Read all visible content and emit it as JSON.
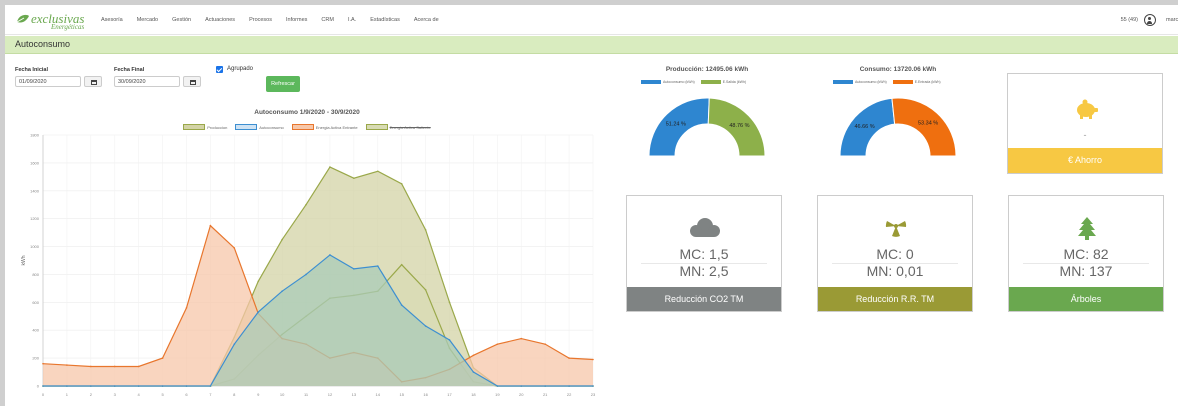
{
  "nav": {
    "logo_word": "exclusivas",
    "logo_sub": "Energéticas",
    "menu": [
      "Asesoría",
      "Mercado",
      "Gestión",
      "Actuaciones",
      "Procesos",
      "Informes",
      "CRM",
      "I.A.",
      "Estadísticas",
      "Acerca de"
    ],
    "count": "55 (49)",
    "user": "marco"
  },
  "page_title": "Autoconsumo",
  "filters": {
    "fecha_inicial_label": "Fecha Inicial",
    "fecha_inicial_value": "01/09/2020",
    "fecha_final_label": "Fecha Final",
    "fecha_final_value": "30/09/2020",
    "agrupado_label": "Agrupado",
    "agrupado_checked": true,
    "refresh_label": "Refrescar"
  },
  "chart_data": [
    {
      "type": "area",
      "title": "Autoconsumo 1/9/2020 - 30/9/2020",
      "xlabel": "",
      "ylabel": "kWh",
      "ylim": [
        0,
        1800
      ],
      "x": [
        0,
        1,
        2,
        3,
        4,
        5,
        6,
        7,
        8,
        9,
        10,
        11,
        12,
        13,
        14,
        15,
        16,
        17,
        18,
        19,
        20,
        21,
        22,
        23
      ],
      "yticks": [
        0,
        200,
        400,
        600,
        800,
        1000,
        1200,
        1400,
        1600,
        1800
      ],
      "grid": true,
      "legend_position": "top",
      "series": [
        {
          "name": "Produccion",
          "color": "#9aa84a",
          "fill": "#d3d3a6",
          "values": [
            0,
            0,
            0,
            0,
            0,
            0,
            0,
            0,
            350,
            750,
            1050,
            1300,
            1570,
            1490,
            1540,
            1450,
            1120,
            600,
            130,
            0,
            0,
            0,
            0,
            0
          ]
        },
        {
          "name": "Autoconsumo",
          "color": "#3d8fd1",
          "fill": "#a9cbb8",
          "values": [
            0,
            0,
            0,
            0,
            0,
            0,
            0,
            0,
            300,
            530,
            680,
            800,
            940,
            840,
            860,
            580,
            430,
            330,
            100,
            0,
            0,
            0,
            0,
            0
          ]
        },
        {
          "name": "Energia Activa Entrante",
          "color": "#e8762d",
          "fill": "#f7c7a9",
          "values": [
            160,
            150,
            140,
            140,
            140,
            200,
            560,
            1150,
            990,
            520,
            340,
            300,
            200,
            240,
            200,
            30,
            60,
            120,
            220,
            300,
            340,
            300,
            200,
            190
          ]
        },
        {
          "name": "Energia Activa Saliente",
          "color": "#9aa84a",
          "fill": "#d8dbb4",
          "values": [
            0,
            0,
            0,
            0,
            0,
            0,
            0,
            0,
            50,
            220,
            370,
            500,
            630,
            650,
            680,
            870,
            690,
            270,
            30,
            0,
            0,
            0,
            0,
            0
          ]
        }
      ]
    },
    {
      "type": "pie",
      "title": "Producción: 12495.06 kWh",
      "categories": [
        "Autoconsumo (kWh)",
        "E.Salida (kWh)"
      ],
      "values": [
        51.24,
        48.76
      ],
      "colors": [
        "#2e86d0",
        "#8db04a"
      ]
    },
    {
      "type": "pie",
      "title": "Consumo: 13720.06 kWh",
      "categories": [
        "Autoconsumo (kWh)",
        "E.Entrada (kWh)"
      ],
      "values": [
        46.66,
        53.34
      ],
      "colors": [
        "#2e86d0",
        "#ef6f0f"
      ]
    }
  ],
  "cards": {
    "ahorro": {
      "value": "-",
      "footer": "€ Ahorro",
      "color": "#f7c843",
      "icon": "piggy-bank-icon"
    },
    "co2": {
      "mc": "MC: 1,5",
      "mn": "MN: 2,5",
      "footer": "Reducción CO2 TM",
      "color": "#7f8383",
      "icon": "cloud-icon"
    },
    "rr": {
      "mc": "MC: 0",
      "mn": "MN: 0,01",
      "footer": "Reducción R.R. TM",
      "color": "#9a9a35",
      "icon": "radiation-icon"
    },
    "arboles": {
      "mc": "MC: 82",
      "mn": "MN: 137",
      "footer": "Árboles",
      "color": "#6aa84f",
      "icon": "tree-icon"
    }
  }
}
